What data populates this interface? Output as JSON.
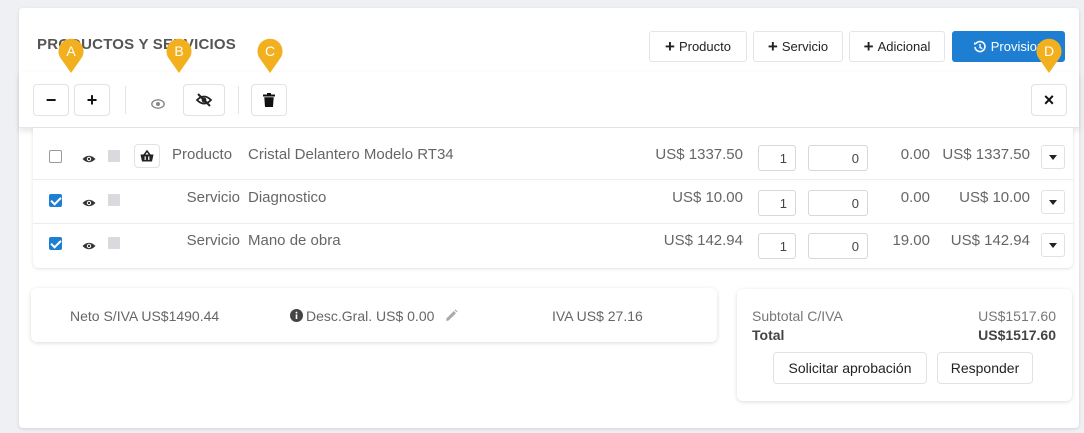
{
  "header": {
    "title": "PRODUCTOS Y SERVICIOS",
    "buttons": {
      "producto": "Producto",
      "servicio": "Servicio",
      "adicional": "Adicional",
      "provision": "Provision"
    }
  },
  "markers": [
    "A",
    "B",
    "C",
    "D"
  ],
  "rows": [
    {
      "checked": false,
      "type": "Producto",
      "description": "Cristal Delantero Modelo RT34",
      "price": "US$ 1337.50",
      "qty": "1",
      "discount": "0",
      "tax": "0.00",
      "total": "US$ 1337.50"
    },
    {
      "checked": true,
      "type": "Servicio",
      "description": "Diagnostico",
      "price": "US$ 10.00",
      "qty": "1",
      "discount": "0",
      "tax": "0.00",
      "total": "US$ 10.00"
    },
    {
      "checked": true,
      "type": "Servicio",
      "description": "Mano de obra",
      "price": "US$ 142.94",
      "qty": "1",
      "discount": "0",
      "tax": "19.00",
      "total": "US$ 142.94"
    }
  ],
  "summary": {
    "neto": "Neto S/IVA US$1490.44",
    "desc": "Desc.Gral. US$ 0.00",
    "iva": "IVA US$ 27.16"
  },
  "totals": {
    "subtotal_label": "Subtotal C/IVA",
    "subtotal_value": "US$1517.60",
    "total_label": "Total",
    "total_value": "US$1517.60"
  },
  "actions": {
    "solicitar": "Solicitar aprobación",
    "responder": "Responder"
  },
  "colors": {
    "accent": "#1e7fd2",
    "marker": "#f2b01e"
  }
}
